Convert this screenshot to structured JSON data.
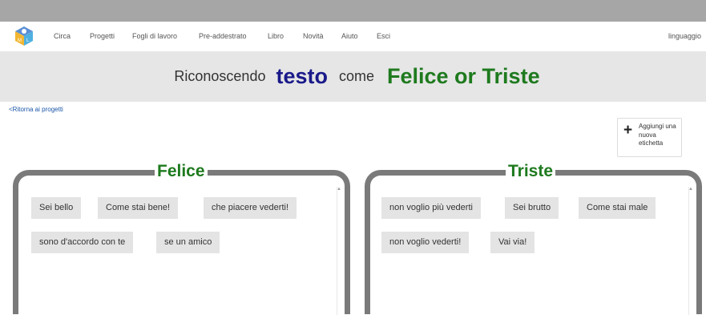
{
  "nav": {
    "items": [
      "Circa",
      "Progetti",
      "Fogli di lavoro",
      "Pre-addestrato",
      "Libro",
      "Novità",
      "Aiuto",
      "Esci"
    ],
    "language": "linguaggio"
  },
  "banner": {
    "prefix": "Riconoscendo",
    "type": "testo",
    "middle": "come",
    "labels": "Felice or Triste"
  },
  "back_link": "<Ritorna ai progetti",
  "add_label": {
    "icon": "plus-icon",
    "text": "Aggiungi una nuova etichetta"
  },
  "buckets": [
    {
      "title": "Felice",
      "examples": [
        "Sei bello",
        "Come stai bene!",
        "che piacere vederti!",
        "sono d'accordo con te",
        "se un amico"
      ]
    },
    {
      "title": "Triste",
      "examples": [
        "non voglio più vederti",
        "Sei brutto",
        "Come stai male",
        "non voglio vederti!",
        "Vai via!"
      ]
    }
  ],
  "colors": {
    "label_green": "#1e7a1e",
    "type_blue": "#1a1a8a",
    "bucket_border": "#7a7a7a",
    "banner_bg": "#e6e6e6",
    "chip_bg": "#e4e4e4"
  }
}
